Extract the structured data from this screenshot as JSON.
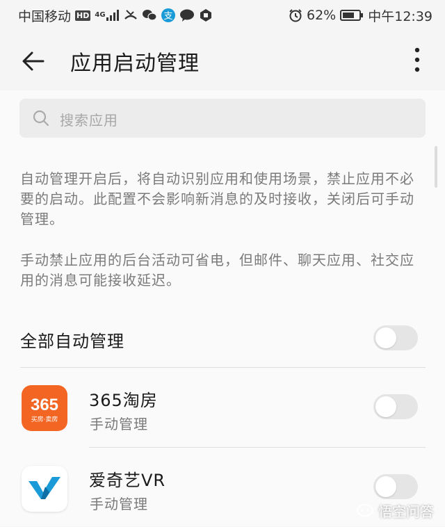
{
  "status_bar": {
    "carrier": "中国移动",
    "hd": "HD",
    "network": "4G",
    "battery": "62%",
    "time": "中午12:39"
  },
  "app_bar": {
    "title": "应用启动管理",
    "back_icon": "arrow-left-icon",
    "more_icon": "more-vertical-icon"
  },
  "search": {
    "placeholder": "搜索应用"
  },
  "description": {
    "paragraph1": "自动管理开启后，将自动识别应用和使用场景，禁止应用不必要的启动。此配置不会影响新消息的及时接收，关闭后可手动管理。",
    "paragraph2": "手动禁止应用的后台活动可省电，但邮件、聊天应用、社交应用的消息可能接收延迟。"
  },
  "all_auto": {
    "label": "全部自动管理",
    "enabled": false
  },
  "apps": [
    {
      "name": "365淘房",
      "mode": "手动管理",
      "icon_text": "365",
      "icon_subtext": "买房·卖房",
      "icon_color": "#f26522",
      "enabled": false
    },
    {
      "name": "爱奇艺VR",
      "mode": "手动管理",
      "icon_color": "#1a9bd7",
      "enabled": false
    }
  ],
  "watermark": {
    "text": "悟空问答"
  }
}
